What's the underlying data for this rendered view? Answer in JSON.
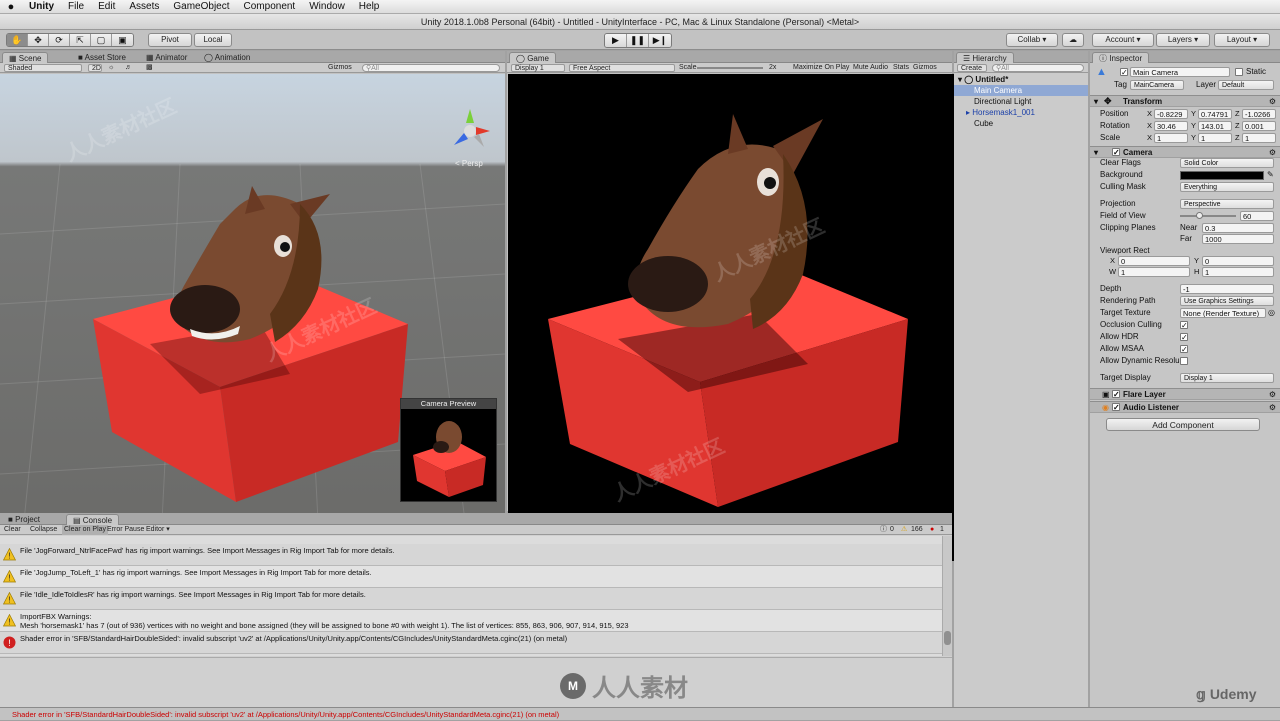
{
  "menu": {
    "apple": "",
    "items": [
      "Unity",
      "File",
      "Edit",
      "Assets",
      "GameObject",
      "Component",
      "Window",
      "Help"
    ]
  },
  "window_title": "Unity 2018.1.0b8 Personal (64bit) - Untitled - UnityInterface - PC, Mac & Linux Standalone (Personal) <Metal>",
  "toolbar": {
    "pivot": "Pivot",
    "local": "Local",
    "collab": "Collab ▾",
    "account": "Account",
    "layers": "Layers",
    "layout": "Layout"
  },
  "scene_panel": {
    "tabs": [
      "Scene",
      "Asset Store",
      "Animator",
      "Animation"
    ],
    "shading": "Shaded",
    "mode_2d": "2D",
    "gizmos": "Gizmos",
    "search_placeholder": "All",
    "persp": "< Persp",
    "camera_preview": "Camera Preview"
  },
  "game_panel": {
    "tab": "Game",
    "display": "Display 1",
    "aspect": "Free Aspect",
    "scale_label": "Scale",
    "scale_value": "2x",
    "maximize": "Maximize On Play",
    "mute": "Mute Audio",
    "stats": "Stats",
    "gizmos": "Gizmos"
  },
  "hierarchy": {
    "tab": "Hierarchy",
    "create": "Create",
    "search_placeholder": "All",
    "scene": "Untitled*",
    "items": [
      {
        "label": "Main Camera",
        "selected": true
      },
      {
        "label": "Directional Light",
        "selected": false
      },
      {
        "label": "Horsemask1_001",
        "selected": false
      },
      {
        "label": "Cube",
        "selected": false
      }
    ]
  },
  "inspector": {
    "tab": "Inspector",
    "object_name": "Main Camera",
    "static": "Static",
    "tag_label": "Tag",
    "tag": "MainCamera",
    "layer_label": "Layer",
    "layer": "Default",
    "transform": {
      "title": "Transform",
      "position_label": "Position",
      "rotation_label": "Rotation",
      "scale_label": "Scale",
      "position": [
        "-0.8229",
        "0.74791",
        "-1.0266"
      ],
      "rotation": [
        "30.46",
        "143.01",
        "0.001"
      ],
      "scale": [
        "1",
        "1",
        "1"
      ]
    },
    "camera": {
      "title": "Camera",
      "clear_flags_label": "Clear Flags",
      "clear_flags": "Solid Color",
      "background_label": "Background",
      "culling_mask_label": "Culling Mask",
      "culling_mask": "Everything",
      "projection_label": "Projection",
      "projection": "Perspective",
      "fov_label": "Field of View",
      "fov": "60",
      "clipping_label": "Clipping Planes",
      "near_label": "Near",
      "near": "0.3",
      "far_label": "Far",
      "far": "1000",
      "viewport_label": "Viewport Rect",
      "vx": "0",
      "vy": "0",
      "vw": "1",
      "vh": "1",
      "depth_label": "Depth",
      "depth": "-1",
      "rendering_path_label": "Rendering Path",
      "rendering_path": "Use Graphics Settings",
      "target_texture_label": "Target Texture",
      "target_texture": "None (Render Texture)",
      "occlusion_label": "Occlusion Culling",
      "hdr_label": "Allow HDR",
      "msaa_label": "Allow MSAA",
      "dynres_label": "Allow Dynamic Resolu",
      "target_display_label": "Target Display",
      "target_display": "Display 1"
    },
    "flare_layer": "Flare Layer",
    "audio_listener": "Audio Listener",
    "add_component": "Add Component"
  },
  "console": {
    "tabs": [
      "Project",
      "Console"
    ],
    "buttons": [
      "Clear",
      "Collapse",
      "Clear on Play",
      "Error Pause",
      "Editor ▾"
    ],
    "count_info": "0",
    "count_warn": "166",
    "count_error": "1",
    "messages": [
      {
        "type": "warning",
        "line1": "File 'JogForward_NtrlFaceFwd' has rig import warnings. See Import Messages in Rig Import Tab for more details.",
        "line2": ""
      },
      {
        "type": "warning",
        "line1": "File 'JogJump_ToLeft_1' has rig import warnings. See Import Messages in Rig Import Tab for more details.",
        "line2": ""
      },
      {
        "type": "warning",
        "line1": "File 'Idle_IdleToIdlesR' has rig import warnings. See Import Messages in Rig Import Tab for more details.",
        "line2": ""
      },
      {
        "type": "warning",
        "line1": "ImportFBX Warnings:",
        "line2": "Mesh 'horsemask1' has 7 (out of 936) vertices with no weight and bone assigned (they will be assigned to bone #0 with weight 1). The list of vertices: 855, 863, 906, 907, 914, 915, 923"
      },
      {
        "type": "error",
        "line1": "Shader error in 'SFB/StandardHairDoubleSided': invalid subscript 'uv2' at /Applications/Unity/Unity.app/Contents/CGIncludes/UnityStandardMeta.cginc(21) (on metal)",
        "line2": ""
      }
    ]
  },
  "status_bar": "Shader error in 'SFB/StandardHairDoubleSided': invalid subscript 'uv2' at /Applications/Unity/Unity.app/Contents/CGIncludes/UnityStandardMeta.cginc(21) (on metal)",
  "watermark": "人人素材社区",
  "brand_logo": "人人素材",
  "udemy": "Udemy",
  "colors": {
    "cube": "#ff4a42",
    "error": "#cc0000",
    "warning": "#f0c020",
    "selection": "#8fa8d4"
  }
}
